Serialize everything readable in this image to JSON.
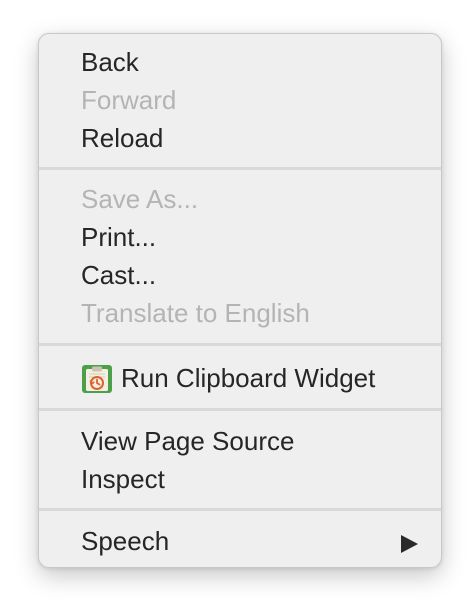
{
  "menu": {
    "groups": [
      {
        "items": [
          {
            "label": "Back",
            "enabled": true
          },
          {
            "label": "Forward",
            "enabled": false
          },
          {
            "label": "Reload",
            "enabled": true
          }
        ]
      },
      {
        "items": [
          {
            "label": "Save As...",
            "enabled": false
          },
          {
            "label": "Print...",
            "enabled": true
          },
          {
            "label": "Cast...",
            "enabled": true
          },
          {
            "label": "Translate to English",
            "enabled": false
          }
        ]
      },
      {
        "items": [
          {
            "label": "Run Clipboard Widget",
            "enabled": true,
            "icon": "clipboard-widget-icon"
          }
        ]
      },
      {
        "items": [
          {
            "label": "View Page Source",
            "enabled": true
          },
          {
            "label": "Inspect",
            "enabled": true
          }
        ]
      },
      {
        "items": [
          {
            "label": "Speech",
            "enabled": true,
            "submenu_icon": "submenu-arrow-icon"
          }
        ]
      }
    ]
  },
  "colors": {
    "menu_background": "#efefef",
    "text_enabled": "#262626",
    "text_disabled": "#b4b4b4",
    "separator": "#d9d9d9",
    "icon_green": "#4e9f4a",
    "icon_orange": "#e0622b"
  }
}
